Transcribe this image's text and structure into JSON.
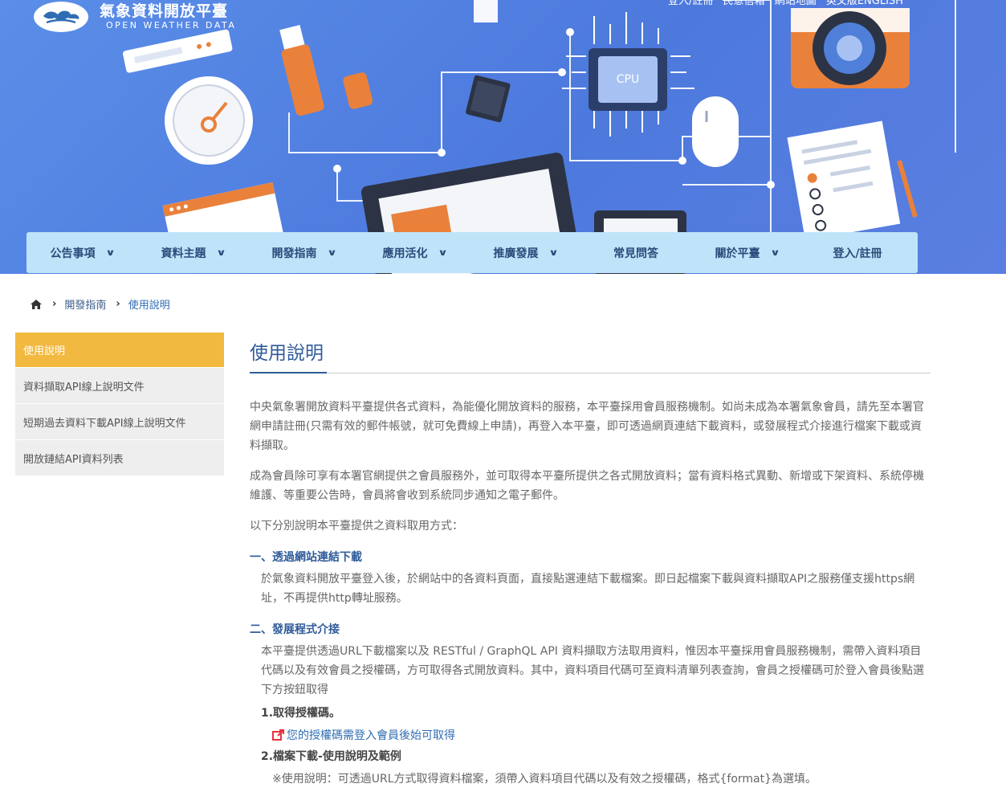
{
  "header": {
    "logo_zh": "氣象資料開放平臺",
    "logo_en": "OPEN WEATHER DATA",
    "top_links": [
      "登入/註冊",
      "民意信箱",
      "網站地圖",
      "英文版ENGLISH"
    ]
  },
  "nav": {
    "items": [
      {
        "label": "公告事項",
        "dropdown": true
      },
      {
        "label": "資料主題",
        "dropdown": true
      },
      {
        "label": "開發指南",
        "dropdown": true
      },
      {
        "label": "應用活化",
        "dropdown": true
      },
      {
        "label": "推廣發展",
        "dropdown": true
      },
      {
        "label": "常見問答",
        "dropdown": false
      },
      {
        "label": "關於平臺",
        "dropdown": true
      },
      {
        "label": "登入/註冊",
        "dropdown": false
      }
    ]
  },
  "breadcrumb": {
    "items": [
      "開發指南",
      "使用說明"
    ]
  },
  "sidebar": {
    "items": [
      {
        "label": "使用說明",
        "active": true
      },
      {
        "label": "資料擷取API線上說明文件",
        "active": false
      },
      {
        "label": "短期過去資料下載API線上說明文件",
        "active": false
      },
      {
        "label": "開放鏈結API資料列表",
        "active": false
      }
    ]
  },
  "main": {
    "title": "使用說明",
    "p1": "中央氣象署開放資料平臺提供各式資料，為能優化開放資料的服務，本平臺採用會員服務機制。如尚未成為本署氣象會員，請先至本署官網申請註冊(只需有效的郵件帳號，就可免費線上申請)，再登入本平臺，即可透過網頁連結下載資料，或發展程式介接進行檔案下載或資料擷取。",
    "p2": "成為會員除可享有本署官網提供之會員服務外，並可取得本平臺所提供之各式開放資料；當有資料格式異動、新增或下架資料、系統停機維護、等重要公告時，會員將會收到系統同步通知之電子郵件。",
    "p3": "以下分別說明本平臺提供之資料取用方式：",
    "h1": "一、透過網站連結下載",
    "s1": "於氣象資料開放平臺登入後，於網站中的各資料頁面，直接點選連結下載檔案。即日起檔案下載與資料擷取API之服務僅支援https網址，不再提供http轉址服務。",
    "h2": "二、發展程式介接",
    "s2": "本平臺提供透過URL下載檔案以及 RESTful / GraphQL API 資料擷取方法取用資料，惟因本平臺採用會員服務機制，需帶入資料項目代碼以及有效會員之授權碼，方可取得各式開放資料。其中，資料項目代碼可至資料清單列表查詢，會員之授權碼可於登入會員後點選下方按鈕取得",
    "sub1": "1.取得授權碼。",
    "auth_link": "您的授權碼需登入會員後始可取得",
    "sub2": "2.檔案下載-使用說明及範例",
    "note": "※使用說明：可透過URL方式取得資料檔案，須帶入資料項目代碼以及有效之授權碼，格式{format}為選填。"
  },
  "colors": {
    "banner": "#5a8ee8",
    "nav_bg": "#bfe4f9",
    "active_side": "#f2b940",
    "title_blue": "#2f5b9a",
    "link_red": "#e8323c"
  }
}
